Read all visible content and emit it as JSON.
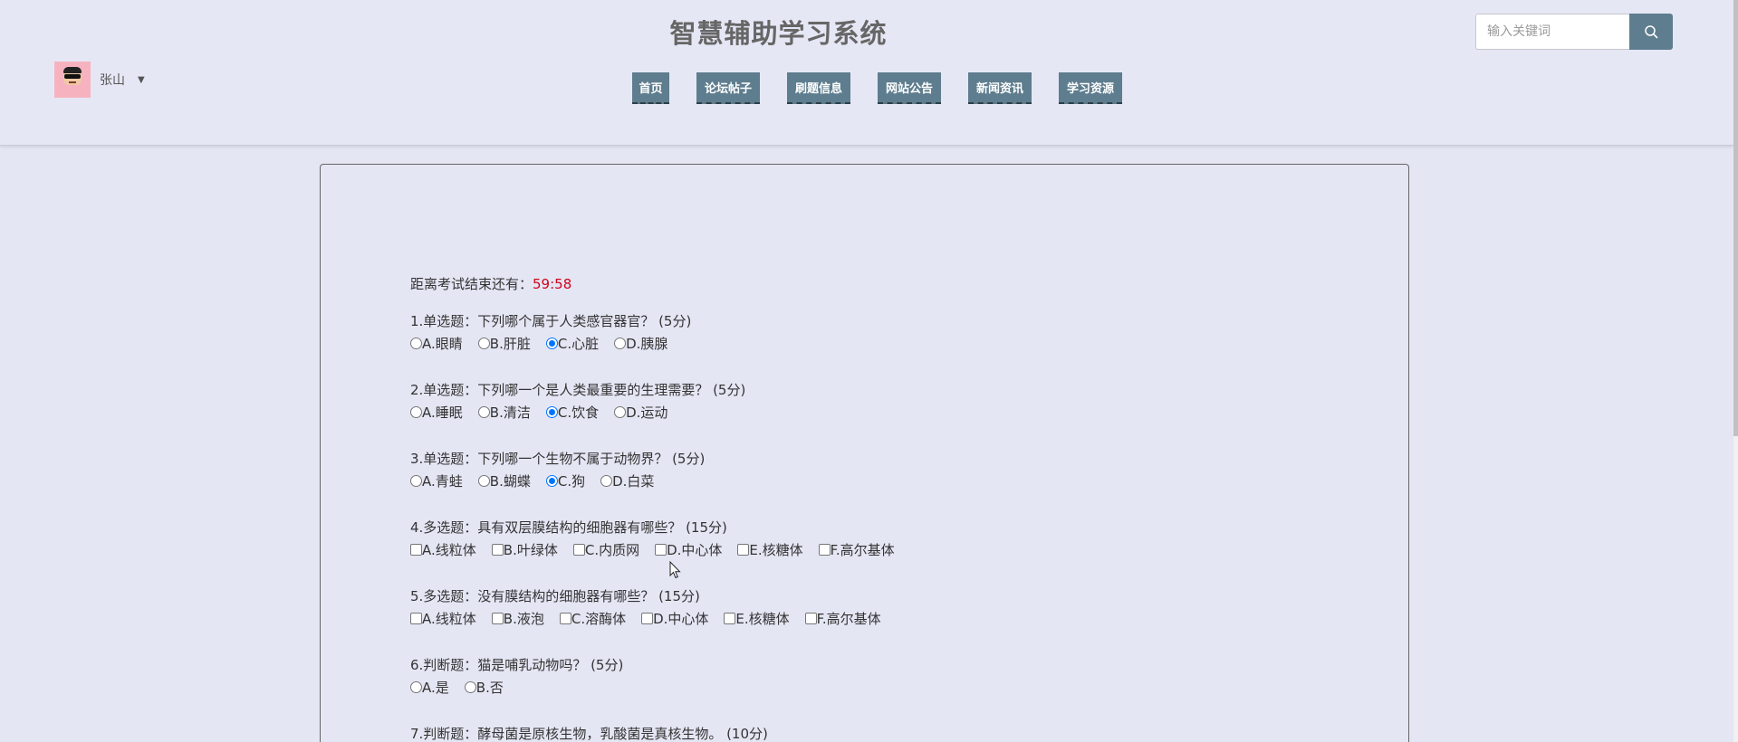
{
  "header": {
    "site_title": "智慧辅助学习系统",
    "user_name": "张山",
    "nav": [
      "首页",
      "论坛帖子",
      "刷题信息",
      "网站公告",
      "新闻资讯",
      "学习资源"
    ],
    "search_placeholder": "输入关键词",
    "search_icon": "search-icon"
  },
  "exam": {
    "timer_label": "距离考试结束还有：",
    "timer_value": "59:58",
    "questions": [
      {
        "title": "1.单选题：下列哪个属于人类感官器官？ (5分)",
        "type": "radio",
        "options": [
          "A.眼睛",
          "B.肝脏",
          "C.心脏",
          "D.胰腺"
        ],
        "selected": "C.心脏"
      },
      {
        "title": "2.单选题：下列哪一个是人类最重要的生理需要？ (5分)",
        "type": "radio",
        "options": [
          "A.睡眠",
          "B.清洁",
          "C.饮食",
          "D.运动"
        ],
        "selected": "C.饮食"
      },
      {
        "title": "3.单选题：下列哪一个生物不属于动物界？ (5分)",
        "type": "radio",
        "options": [
          "A.青蛙",
          "B.蝴蝶",
          "C.狗",
          "D.白菜"
        ],
        "selected": "C.狗"
      },
      {
        "title": "4.多选题：具有双层膜结构的细胞器有哪些？ (15分)",
        "type": "checkbox",
        "options": [
          "A.线粒体",
          "B.叶绿体",
          "C.内质网",
          "D.中心体",
          "E.核糖体",
          "F.高尔基体"
        ],
        "selected": ""
      },
      {
        "title": "5.多选题：没有膜结构的细胞器有哪些？ (15分)",
        "type": "checkbox",
        "options": [
          "A.线粒体",
          "B.液泡",
          "C.溶酶体",
          "D.中心体",
          "E.核糖体",
          "F.高尔基体"
        ],
        "selected": ""
      },
      {
        "title": "6.判断题：猫是哺乳动物吗？ (5分)",
        "type": "radio",
        "options": [
          "A.是",
          "B.否"
        ],
        "selected": ""
      },
      {
        "title": "7.判断题：酵母菌是原核生物，乳酸菌是真核生物。 (10分)",
        "type": "radio",
        "options": [],
        "selected": ""
      }
    ]
  }
}
